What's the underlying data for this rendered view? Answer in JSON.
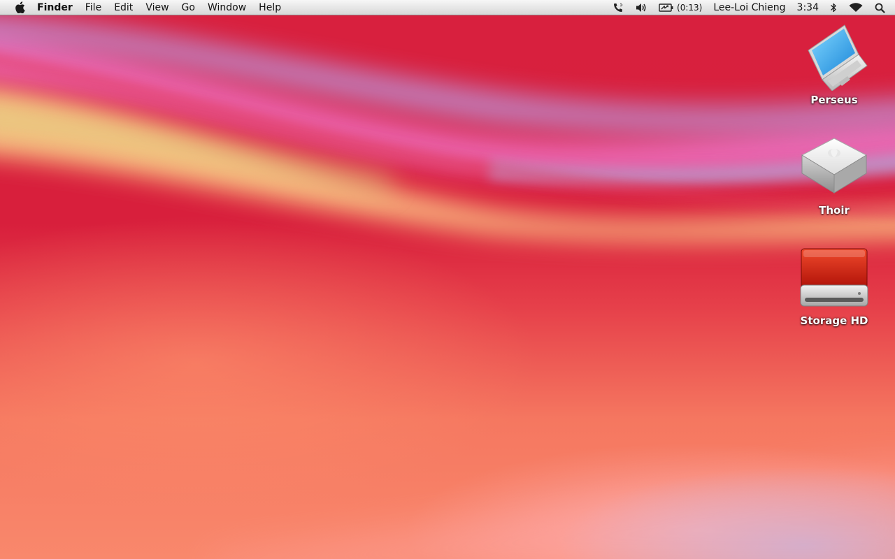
{
  "menubar": {
    "apple_menu_icon": "apple-logo-icon",
    "app_name": "Finder",
    "menus": [
      "File",
      "Edit",
      "View",
      "Go",
      "Window",
      "Help"
    ],
    "status": {
      "phone_icon": "phone-icon",
      "volume_icon": "volume-icon",
      "battery_icon": "battery-charging-icon",
      "battery_time": "(0:13)",
      "user_name": "Lee-Loi Chieng",
      "clock": "3:34",
      "bluetooth_icon": "bluetooth-icon",
      "wifi_icon": "wifi-icon",
      "spotlight_icon": "spotlight-search-icon"
    }
  },
  "desktop": {
    "icons": [
      {
        "label": "Perseus",
        "icon": "laptop-computer-icon"
      },
      {
        "label": "Thoir",
        "icon": "network-drive-icon"
      },
      {
        "label": "Storage HD",
        "icon": "external-hard-drive-icon"
      }
    ]
  },
  "colors": {
    "wallpaper_base": "#d8203e",
    "wallpaper_low": "#f9886c",
    "menubar_bg": "#e8e8e8"
  }
}
